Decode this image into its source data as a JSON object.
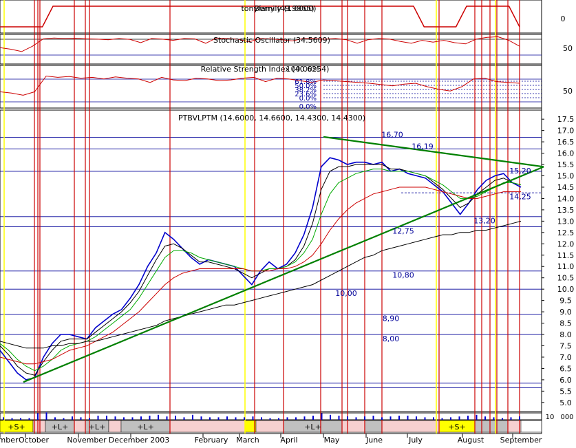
{
  "chart_data": [
    {
      "type": "line",
      "title": "tonyfamily (1.0000)",
      "overlay_text": "Berry (49.9965)",
      "series": [
        {
          "values": [
            0,
            0,
            0,
            0,
            0,
            1,
            1,
            1,
            1,
            1,
            1,
            1,
            1,
            1,
            1,
            1,
            1,
            1,
            1,
            1,
            1,
            1,
            1,
            1,
            1,
            1,
            1,
            1,
            1,
            1,
            1,
            1,
            1,
            1,
            1,
            1,
            1,
            1,
            1,
            1,
            0,
            0,
            0,
            0,
            1,
            1,
            1,
            1,
            1,
            0
          ]
        }
      ],
      "y_ticks": [
        "0"
      ],
      "ylim": [
        -0.3,
        1.3
      ]
    },
    {
      "type": "line",
      "title": "Stochastic Oscillator (34.5609)",
      "y_ticks": [
        "50"
      ],
      "ylim": [
        0,
        100
      ],
      "series": [
        {
          "values": [
            55,
            50,
            42,
            60,
            85,
            88,
            86,
            87,
            85,
            84,
            82,
            86,
            83,
            72,
            86,
            84,
            80,
            86,
            85,
            70,
            88,
            86,
            84,
            75,
            86,
            85,
            82,
            78,
            86,
            86,
            84,
            86,
            82,
            70,
            82,
            86,
            84,
            76,
            70,
            80,
            74,
            80,
            72,
            68,
            84,
            90,
            92,
            80,
            60
          ]
        }
      ]
    },
    {
      "type": "line",
      "title": "Relative Strength Index (40.6254)",
      "overlay_text": "100.00%",
      "fib_levels": [
        "61.8%",
        "50.0%",
        "38.2%",
        "23.6%",
        "0.0%"
      ],
      "y_ticks": [
        "50"
      ],
      "ylim": [
        0,
        100
      ],
      "series": [
        {
          "values": [
            38,
            35,
            30,
            38,
            75,
            72,
            74,
            70,
            72,
            68,
            73,
            70,
            68,
            60,
            72,
            66,
            64,
            70,
            68,
            64,
            66,
            70,
            72,
            62,
            70,
            68,
            64,
            60,
            66,
            64,
            62,
            60,
            58,
            55,
            52,
            56,
            58,
            50,
            44,
            40,
            50,
            68,
            70,
            62,
            60,
            58
          ]
        }
      ]
    },
    {
      "type": "line",
      "title": "PTBVLPTM (14.6000, 14.6600, 14.4300, 14.4300)",
      "y_ticks": [
        "5.0",
        "5.5",
        "6.0",
        "6.5",
        "7.0",
        "7.5",
        "8.0",
        "8.5",
        "9.0",
        "9.5",
        "10.0",
        "10.5",
        "11.0",
        "11.5",
        "12.0",
        "12.5",
        "13.0",
        "13.5",
        "14.0",
        "14.5",
        "15.0",
        "15.5",
        "16.0",
        "16.5",
        "17.0",
        "17.5"
      ],
      "ylim": [
        4.6,
        17.9
      ],
      "levels": [
        "16,70",
        "16,19",
        "15,20",
        "14,25",
        "13,20",
        "12,75",
        "10,80",
        "10,00",
        "8,90",
        "8,00"
      ],
      "level_values": [
        16.7,
        16.19,
        15.2,
        14.25,
        13.2,
        12.75,
        10.8,
        10.0,
        8.9,
        8.0
      ],
      "series": [
        {
          "values": [
            7.3,
            6.8,
            6.3,
            6.0,
            6.1,
            7.0,
            7.6,
            8.0,
            8.0,
            7.9,
            7.8,
            8.3,
            8.6,
            8.9,
            9.1,
            9.6,
            10.2,
            11.0,
            11.6,
            12.5,
            12.2,
            11.8,
            11.4,
            11.1,
            11.3,
            11.2,
            11.1,
            11.0,
            10.6,
            10.2,
            10.8,
            11.2,
            10.9,
            11.1,
            11.6,
            12.4,
            13.6,
            15.4,
            15.8,
            15.7,
            15.5,
            15.6,
            15.6,
            15.5,
            15.6,
            15.2,
            15.3,
            15.1,
            15.0,
            14.9,
            14.6,
            14.3,
            13.8,
            13.3,
            13.8,
            14.4,
            14.8,
            15.0,
            15.1,
            14.7,
            14.5
          ]
        },
        {
          "values": [
            7.5,
            7.1,
            6.6,
            6.3,
            6.2,
            6.8,
            7.3,
            7.7,
            7.8,
            7.8,
            7.8,
            8.1,
            8.4,
            8.7,
            9.0,
            9.4,
            9.9,
            10.6,
            11.3,
            11.9,
            12.0,
            11.8,
            11.5,
            11.2,
            11.2,
            11.1,
            11.0,
            10.9,
            10.7,
            10.5,
            10.7,
            10.9,
            10.9,
            11.0,
            11.3,
            11.9,
            12.9,
            14.4,
            15.2,
            15.4,
            15.4,
            15.5,
            15.5,
            15.5,
            15.5,
            15.3,
            15.3,
            15.2,
            15.1,
            15.0,
            14.7,
            14.4,
            14.0,
            13.6,
            13.8,
            14.2,
            14.5,
            14.8,
            14.9,
            14.7,
            14.6
          ]
        },
        {
          "values": [
            7.6,
            7.3,
            6.9,
            6.6,
            6.4,
            6.6,
            6.9,
            7.3,
            7.5,
            7.6,
            7.7,
            7.9,
            8.2,
            8.5,
            8.8,
            9.1,
            9.6,
            10.2,
            10.8,
            11.4,
            11.7,
            11.7,
            11.6,
            11.4,
            11.3,
            11.2,
            11.1,
            11.0,
            10.9,
            10.8,
            10.8,
            10.9,
            10.9,
            11.0,
            11.2,
            11.6,
            12.2,
            13.3,
            14.2,
            14.7,
            14.9,
            15.1,
            15.2,
            15.3,
            15.3,
            15.2,
            15.2,
            15.2,
            15.1,
            15.0,
            14.8,
            14.6,
            14.3,
            14.0,
            14.0,
            14.1,
            14.3,
            14.5,
            14.7,
            14.7,
            14.6
          ]
        },
        {
          "values": [
            7.0,
            6.9,
            6.8,
            6.7,
            6.7,
            6.8,
            6.9,
            7.1,
            7.3,
            7.4,
            7.5,
            7.7,
            7.9,
            8.1,
            8.4,
            8.7,
            9.0,
            9.4,
            9.8,
            10.2,
            10.5,
            10.7,
            10.8,
            10.9,
            10.9,
            10.9,
            10.9,
            10.9,
            10.9,
            10.8,
            10.8,
            10.8,
            10.9,
            10.9,
            11.0,
            11.2,
            11.5,
            12.0,
            12.6,
            13.1,
            13.5,
            13.8,
            14.0,
            14.2,
            14.3,
            14.4,
            14.5,
            14.5,
            14.5,
            14.5,
            14.4,
            14.3,
            14.2,
            14.1,
            14.0,
            14.0,
            14.1,
            14.2,
            14.3,
            14.3,
            14.3
          ]
        },
        {
          "values": [
            7.7,
            7.6,
            7.5,
            7.4,
            7.4,
            7.4,
            7.5,
            7.5,
            7.6,
            7.6,
            7.7,
            7.7,
            7.8,
            7.9,
            8.0,
            8.1,
            8.2,
            8.3,
            8.4,
            8.6,
            8.7,
            8.8,
            8.9,
            9.0,
            9.1,
            9.2,
            9.3,
            9.3,
            9.4,
            9.5,
            9.6,
            9.7,
            9.8,
            9.9,
            10.0,
            10.1,
            10.2,
            10.4,
            10.6,
            10.8,
            11.0,
            11.2,
            11.4,
            11.5,
            11.7,
            11.8,
            11.9,
            12.0,
            12.1,
            12.2,
            12.3,
            12.4,
            12.4,
            12.5,
            12.5,
            12.6,
            12.6,
            12.7,
            12.8,
            12.9,
            13.0
          ]
        }
      ]
    },
    {
      "type": "bar",
      "title": "",
      "y_ticks": [
        "10",
        "000"
      ],
      "series": [
        {
          "values": [
            3,
            2,
            2,
            2,
            8,
            9,
            3,
            2,
            4,
            3,
            2,
            5,
            5,
            4,
            3,
            3,
            4,
            5,
            6,
            4,
            5,
            3,
            6,
            4,
            3,
            3,
            4,
            3,
            3,
            4,
            3,
            2,
            2,
            3,
            3,
            4,
            5,
            8,
            6,
            5,
            4,
            3,
            4,
            5,
            3,
            4,
            5,
            5,
            4,
            3,
            3,
            2,
            3,
            4,
            5,
            6,
            4,
            3,
            2,
            3,
            4
          ]
        }
      ]
    }
  ],
  "signal_bar": {
    "labels": [
      "+S+",
      "+L+",
      "+L+",
      "+L+",
      "+L+",
      "+S+"
    ]
  },
  "x_axis": {
    "tick_labels": [
      "mber",
      "October",
      "November",
      "December 2003",
      "February",
      "March",
      "April",
      "May",
      "June",
      "July",
      "August",
      "September"
    ]
  },
  "colors": {
    "price_bars": "#0000cc",
    "down_bars": "#ff0000",
    "trendline": "#008000",
    "vertical_red": "#cc0000",
    "vertical_yellow": "#ffff00",
    "signal_yellow": "#ffff00",
    "signal_gray": "#c0c0c0",
    "level_lines": "#000099",
    "ma_black": "#000000",
    "ma_red": "#cc0000",
    "ma_green": "#00aa00"
  }
}
